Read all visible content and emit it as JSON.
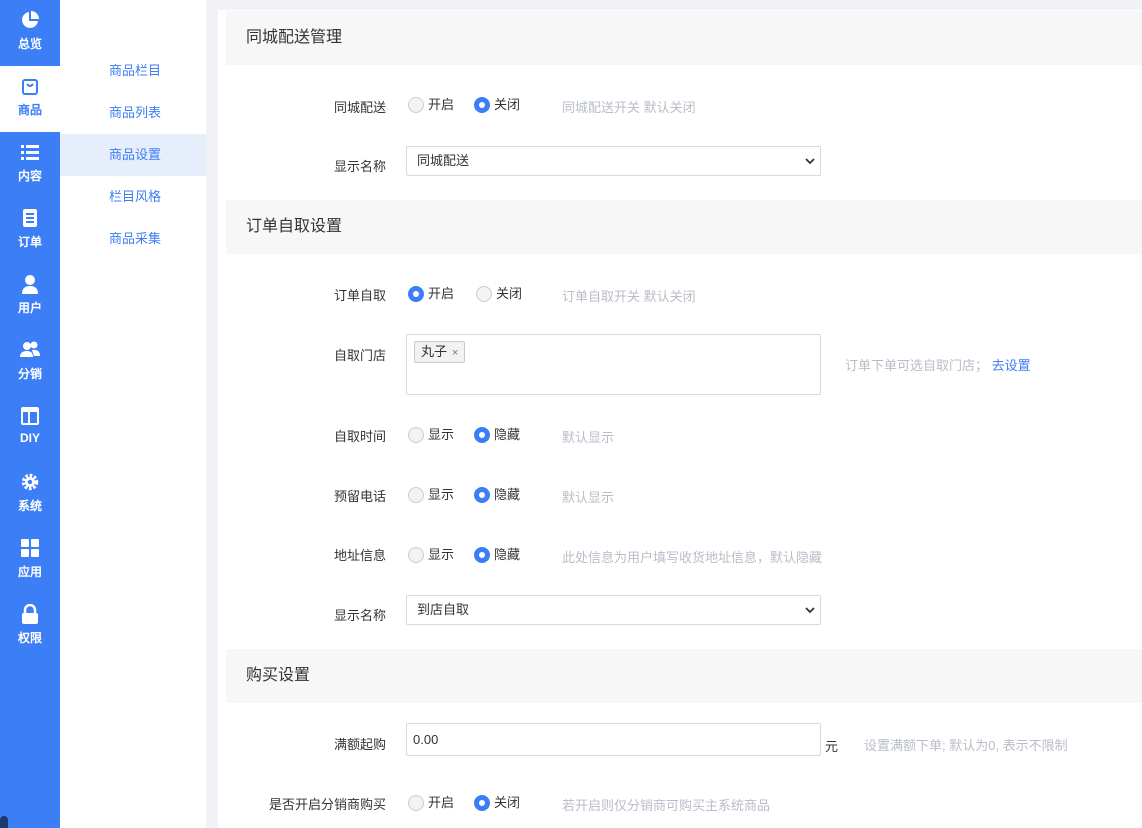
{
  "nav": {
    "items": [
      {
        "label": "总览",
        "icon": "pie-chart-icon"
      },
      {
        "label": "商品",
        "icon": "shopping-bag-icon"
      },
      {
        "label": "内容",
        "icon": "list-icon"
      },
      {
        "label": "订单",
        "icon": "order-document-icon"
      },
      {
        "label": "用户",
        "icon": "user-icon"
      },
      {
        "label": "分销",
        "icon": "users-icon"
      },
      {
        "label": "DIY",
        "icon": "layout-icon"
      },
      {
        "label": "系统",
        "icon": "gear-icon"
      },
      {
        "label": "应用",
        "icon": "apps-grid-icon"
      },
      {
        "label": "权限",
        "icon": "lock-icon"
      }
    ],
    "active": "商品",
    "accent": "#3c7ef6"
  },
  "subnav": {
    "items": [
      "商品栏目",
      "商品列表",
      "商品设置",
      "栏目风格",
      "商品采集"
    ],
    "active": "商品设置"
  },
  "city_delivery": {
    "title": "同城配送管理",
    "switch": {
      "label": "同城配送",
      "on": "开启",
      "off": "关闭",
      "selected": "关闭",
      "hint": "同城配送开关 默认关闭"
    },
    "display_name": {
      "label": "显示名称",
      "value": "同城配送"
    }
  },
  "pickup": {
    "title": "订单自取设置",
    "switch": {
      "label": "订单自取",
      "on": "开启",
      "off": "关闭",
      "selected": "开启",
      "hint": "订单自取开关 默认关闭"
    },
    "stores": {
      "label": "自取门店",
      "tags": [
        "丸子"
      ],
      "tag_remove": "×",
      "hint": "订单下单可选自取门店；",
      "link": "去设置"
    },
    "time": {
      "label": "自取时间",
      "show": "显示",
      "hide": "隐藏",
      "selected": "隐藏",
      "hint": "默认显示"
    },
    "phone": {
      "label": "预留电话",
      "show": "显示",
      "hide": "隐藏",
      "selected": "隐藏",
      "hint": "默认显示"
    },
    "address": {
      "label": "地址信息",
      "show": "显示",
      "hide": "隐藏",
      "selected": "隐藏",
      "hint": "此处信息为用户填写收货地址信息，默认隐藏"
    },
    "display_name": {
      "label": "显示名称",
      "value": "到店自取"
    }
  },
  "purchase": {
    "title": "购买设置",
    "min_amount": {
      "label": "满额起购",
      "value": "0.00",
      "unit": "元",
      "hint": "设置满额下单; 默认为0, 表示不限制"
    },
    "distributor": {
      "label": "是否开启分销商购买",
      "on": "开启",
      "off": "关闭",
      "selected": "关闭",
      "hint": "若开启则仅分销商可购买主系统商品"
    }
  }
}
